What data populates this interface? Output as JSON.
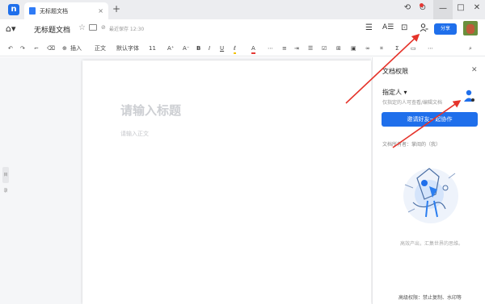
{
  "tabbar": {
    "tab_label": "无标题文档",
    "close": "×",
    "new_tab": "+",
    "window_controls": [
      "⟲",
      "⊙",
      "—",
      "□",
      "✕"
    ]
  },
  "header": {
    "doc_title": "无标题文档",
    "save_status": "最近保存 12:30",
    "share_label": "分享"
  },
  "toolbar": {
    "insert_label": "插入",
    "style_label": "正文",
    "font_label": "默认字体",
    "size_label": "11"
  },
  "editor": {
    "title_placeholder": "请输入标题",
    "body_placeholder": "请输入正文"
  },
  "sidebar_toggle": "目录",
  "panel": {
    "title": "文档权限",
    "owner_label": "指定人",
    "owner_sub": "仅指定的人可查看/编辑文档",
    "invite_button": "邀请好友一起协作",
    "access_text": "文档所有者：掌阅的（我）",
    "caption": "高效产出，汇集世界的思维。",
    "footer": "高级权限：禁止复制、水印等"
  },
  "colors": {
    "accent": "#1f6feb",
    "annotation_arrow": "#e5332a"
  }
}
